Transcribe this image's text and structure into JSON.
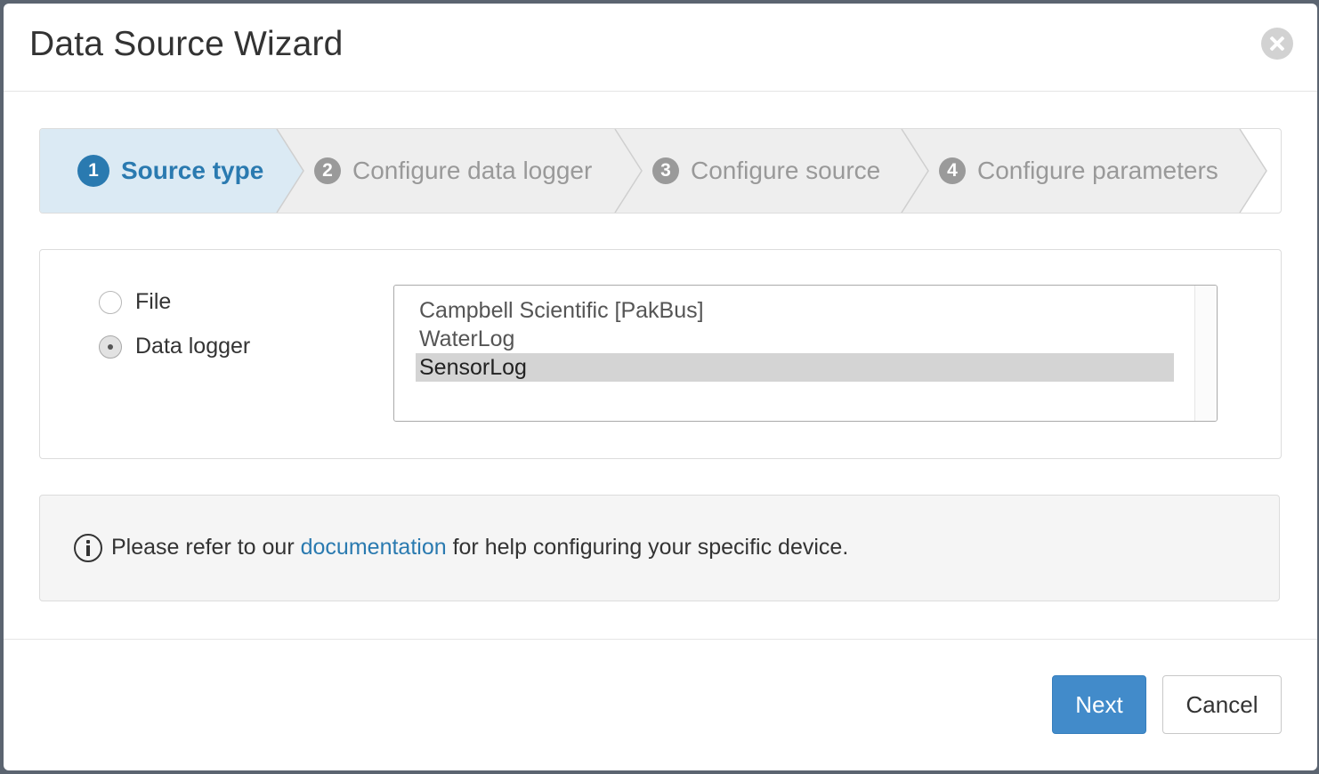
{
  "dialog": {
    "title": "Data Source Wizard",
    "close_icon": "close-icon"
  },
  "steps": [
    {
      "number": "1",
      "label": "Source type",
      "active": true
    },
    {
      "number": "2",
      "label": "Configure data logger",
      "active": false
    },
    {
      "number": "3",
      "label": "Configure source",
      "active": false
    },
    {
      "number": "4",
      "label": "Configure parameters",
      "active": false
    }
  ],
  "source_type": {
    "options": [
      {
        "label": "File",
        "checked": false
      },
      {
        "label": "Data logger",
        "checked": true
      }
    ]
  },
  "logger_list": {
    "items": [
      {
        "label": "Campbell Scientific [PakBus]",
        "selected": false
      },
      {
        "label": "WaterLog",
        "selected": false
      },
      {
        "label": "SensorLog",
        "selected": true
      }
    ]
  },
  "info": {
    "icon": "info-icon",
    "text_before": "Please refer to our ",
    "link": "documentation",
    "text_after": " for help configuring your specific device."
  },
  "footer": {
    "next_label": "Next",
    "cancel_label": "Cancel"
  },
  "colors": {
    "accent": "#2a7ab0",
    "primary_button": "#428bca",
    "active_step_bg": "#dbeaf4",
    "inactive_step_bg": "#eeeeee"
  }
}
